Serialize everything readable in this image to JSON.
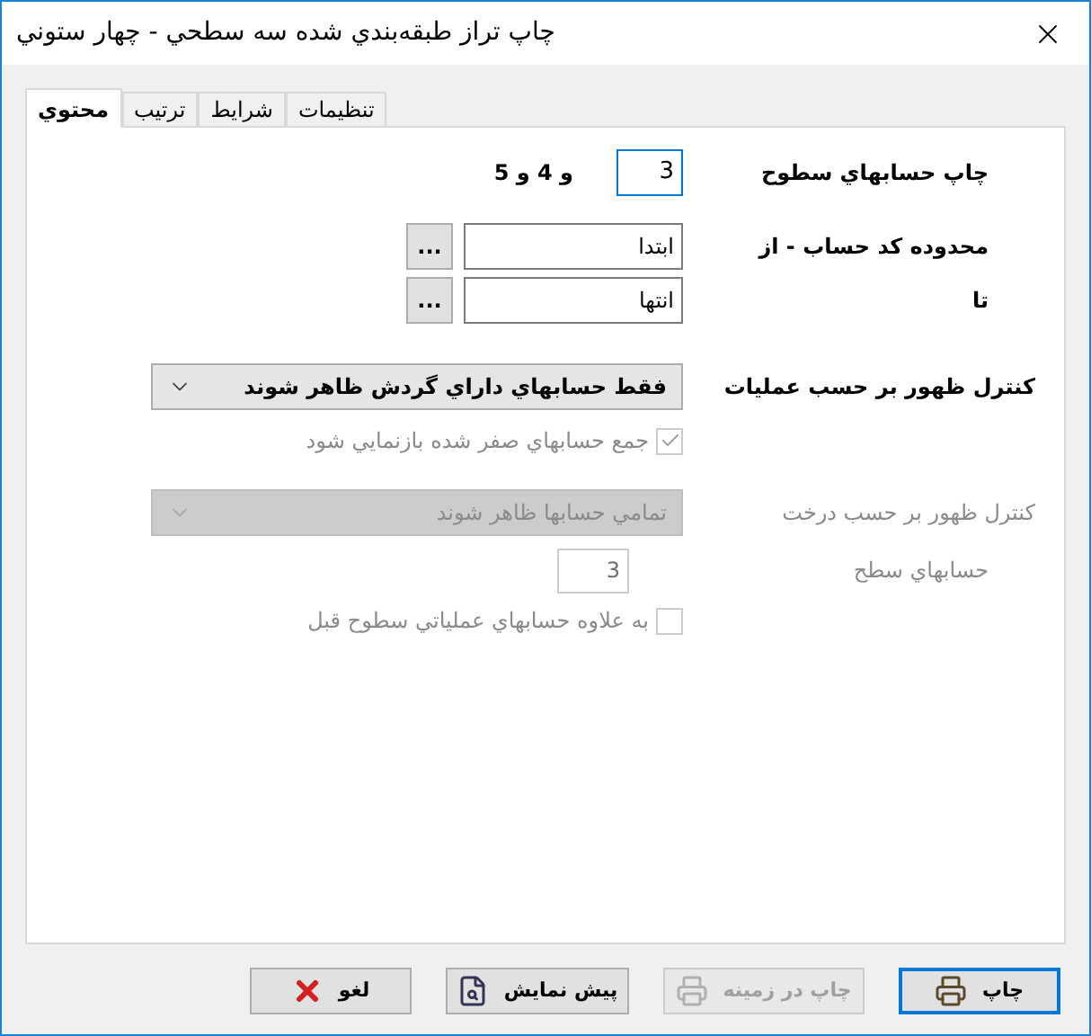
{
  "window": {
    "title": "چاپ تراز طبقه‌بندي شده سه سطحي - چهار ستوني"
  },
  "tabs": [
    {
      "label": "تنظيمات",
      "selected": false
    },
    {
      "label": "شرايط",
      "selected": false
    },
    {
      "label": "ترتيب",
      "selected": false
    },
    {
      "label": "محتوي",
      "selected": true
    }
  ],
  "print_levels": {
    "label": "چاپ حسابهاي سطوح",
    "value": "3",
    "suffix": "و 4 و 5",
    "focused": true
  },
  "range_from": {
    "label": "محدوده کد حساب - از",
    "value": "ابتدا",
    "button": "..."
  },
  "range_to": {
    "label": "تا",
    "value": "انتها",
    "button": "..."
  },
  "operations_control": {
    "label": "کنترل ظهور بر حسب عمليات",
    "value": "فقط حسابهاي داراي گردش ظاهر شوند",
    "disabled": false
  },
  "zero_sum": {
    "label": "جمع حسابهاي صفر شده بازنمايي شود",
    "checked": true,
    "disabled": true
  },
  "tree_control": {
    "label": "کنترل ظهور بر حسب درخت",
    "value": "تمامي حسابها ظاهر شوند",
    "disabled": true
  },
  "levels": {
    "label": "حسابهاي سطح",
    "value": "3",
    "disabled": true
  },
  "include_previous": {
    "label": "به علاوه حسابهاي عملياتي سطوح قبل",
    "checked": false,
    "disabled": true
  },
  "buttons": [
    {
      "label": "چاپ",
      "kind": "print",
      "disabled": false,
      "default": true
    },
    {
      "label": "چاپ در زمينه",
      "kind": "background",
      "disabled": true,
      "default": false
    },
    {
      "label": "پيش نمايش",
      "kind": "preview",
      "disabled": false,
      "default": false
    },
    {
      "label": "لغو",
      "kind": "cancel",
      "disabled": false,
      "default": false
    }
  ]
}
